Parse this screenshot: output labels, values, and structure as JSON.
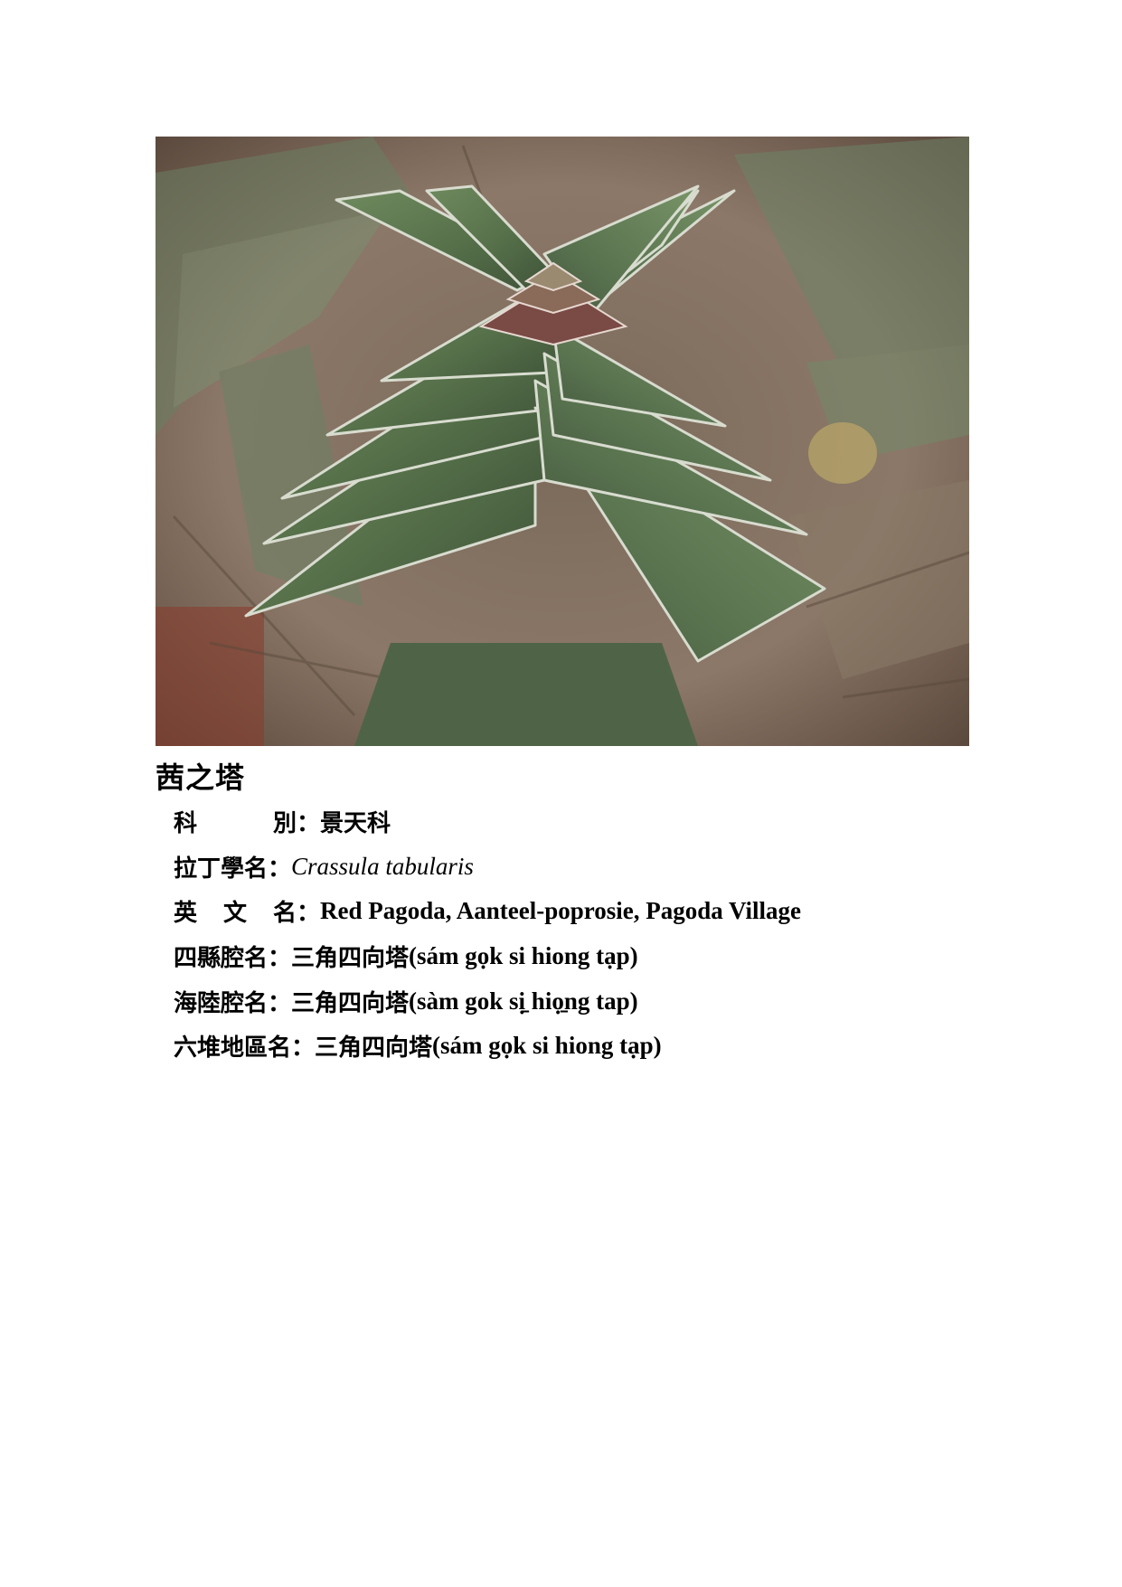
{
  "plant": {
    "name": "茜之塔",
    "image_alt": "Crassula tabularis plant photo"
  },
  "fields": [
    {
      "label": "科　　別",
      "chars": [
        "科",
        "別"
      ],
      "value": "景天科"
    },
    {
      "label": "拉丁學名",
      "value": "Crassula tabularis"
    },
    {
      "label": "英 文 名",
      "chars": [
        "英",
        "文",
        "名"
      ],
      "value": "Red Pagoda, Aanteel-poprosie, Pagoda Village"
    },
    {
      "label": "四縣腔名",
      "value_cjk": "三角四向塔",
      "value_roman": "(sám gọk si hiong tạp)"
    },
    {
      "label": "海陸腔名",
      "value_cjk": "三角四向塔",
      "value_roman": "(sàm gok sị̱ hiọ̱ng tap)"
    },
    {
      "label": "六堆地區名",
      "value_cjk": "三角四向塔",
      "value_roman": "(sám gọk si hiong tạp)"
    }
  ],
  "colon": "：",
  "colors": {
    "text": "#000000",
    "background": "#ffffff"
  }
}
